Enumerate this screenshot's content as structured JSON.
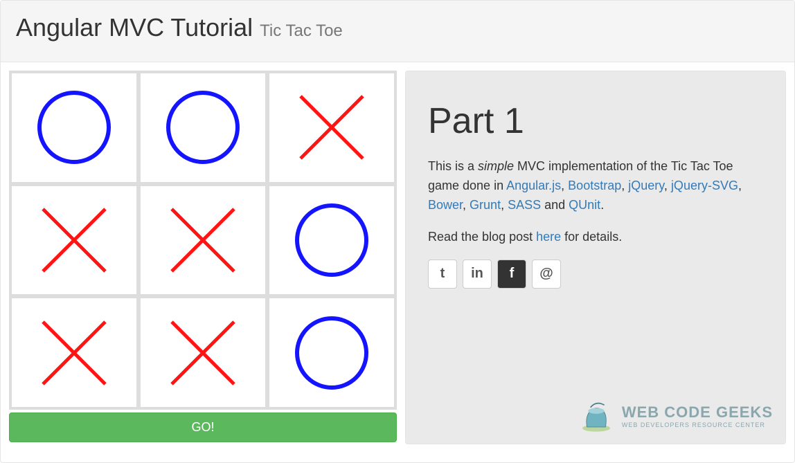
{
  "header": {
    "title": "Angular MVC Tutorial",
    "subtitle": "Tic Tac Toe"
  },
  "board": {
    "cells": [
      "O",
      "O",
      "X",
      "X",
      "X",
      "O",
      "X",
      "X",
      "O"
    ],
    "go_label": "GO!"
  },
  "aside": {
    "heading": "Part 1",
    "intro_lead": "This is a ",
    "intro_em": "simple",
    "intro_mid": " MVC implementation of the Tic Tac Toe game done in ",
    "links": [
      "Angular.js",
      "Bootstrap",
      "jQuery",
      "jQuery-SVG",
      "Bower",
      "Grunt",
      "SASS",
      "QUnit"
    ],
    "blog_lead": "Read the blog post ",
    "blog_link": "here",
    "blog_tail": " for details.",
    "social": {
      "twitter": "t",
      "linkedin": "in",
      "facebook": "f",
      "email": "@"
    },
    "logo": {
      "line1": "WEB CODE GEEKS",
      "line2": "WEB DEVELOPERS RESOURCE CENTER"
    }
  }
}
